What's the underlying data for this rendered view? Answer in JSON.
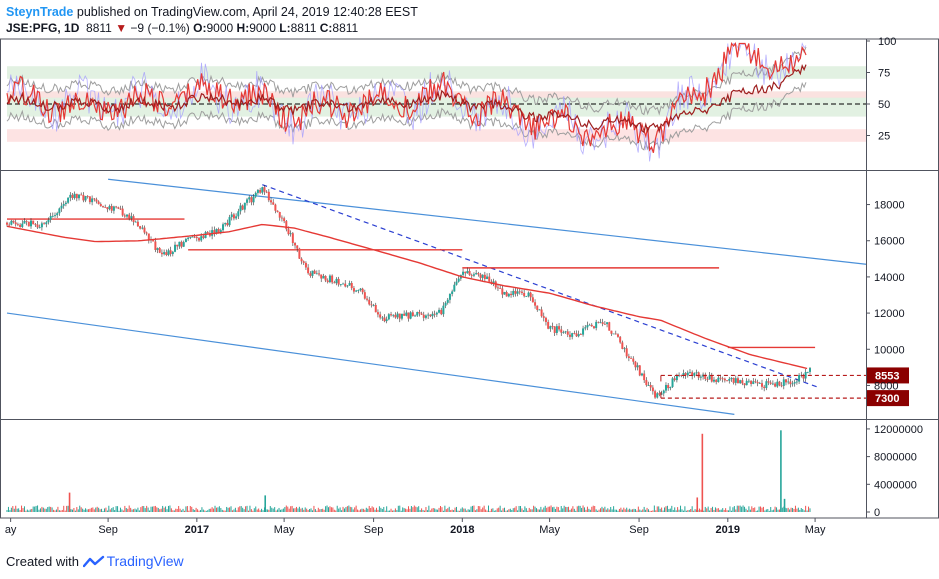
{
  "header": {
    "author": "SteynTrade",
    "published_text": "published on TradingView.com, April 24, 2019 12:40:28 EEST",
    "symbol": "JSE:PFG, 1D",
    "last": "8811",
    "change": "−9 (−0.1%)",
    "o_label": "O:",
    "o_value": "9000",
    "h_label": "H:",
    "h_value": "9000",
    "l_label": "L:",
    "l_value": "8811",
    "c_label": "C:",
    "c_value": "8811"
  },
  "footer": {
    "created_with": "Created with",
    "brand": "TradingView"
  },
  "colors": {
    "candle_up": "#26a69a",
    "candle_down": "#ef5350",
    "ma": "#e53935",
    "channel": "#4a90d9",
    "trendline": "#2b3fd1",
    "resistance": "#e53935",
    "support": "#b71c1c",
    "osc_main": "#e53935",
    "osc_signal": "#9e1f1f",
    "osc_fast": "#a29bfe",
    "osc_bands": "#9e9e9e",
    "zone_green": "#dff0df",
    "zone_red": "#fde0e0",
    "badge_bg": "#8b0000"
  },
  "chart_data": [
    {
      "type": "line",
      "panel": "oscillator",
      "y_axis_ticks": [
        "100",
        "75",
        "50",
        "25"
      ],
      "ylim": [
        0,
        100
      ],
      "reference_level": 50,
      "zones": [
        {
          "from": 70,
          "to": 80,
          "color": "green"
        },
        {
          "from": 40,
          "to": 60,
          "color": "green"
        },
        {
          "from": 55,
          "to": 60,
          "color": "red"
        },
        {
          "from": 20,
          "to": 30,
          "color": "red"
        }
      ],
      "x": [
        "2016-05",
        "2016-09",
        "2017-01",
        "2017-05",
        "2017-09",
        "2018-01",
        "2018-05",
        "2018-09",
        "2018-12",
        "2019-01",
        "2019-03",
        "2019-04"
      ],
      "series": [
        {
          "values": [
            55,
            48,
            52,
            60,
            42,
            50,
            58,
            40,
            30,
            28,
            90,
            78
          ]
        },
        {
          "values": [
            52,
            50,
            49,
            55,
            47,
            51,
            54,
            45,
            36,
            33,
            55,
            75
          ]
        }
      ]
    },
    {
      "type": "candlestick",
      "panel": "price",
      "y_axis_ticks": [
        "18000",
        "16000",
        "14000",
        "12000",
        "10000",
        "8000"
      ],
      "ylim": [
        6200,
        19800
      ],
      "x_ticks": [
        "ay",
        "Sep",
        "2017",
        "May",
        "Sep",
        "2018",
        "May",
        "Sep",
        "2019",
        "May"
      ],
      "x_range": [
        "2016-04-15",
        "2019-07-10"
      ],
      "price_path": [
        {
          "date": "2016-04-15",
          "price": 17000
        },
        {
          "date": "2016-06-01",
          "price": 16900
        },
        {
          "date": "2016-07-15",
          "price": 18500
        },
        {
          "date": "2016-08-20",
          "price": 18100
        },
        {
          "date": "2016-10-01",
          "price": 17400
        },
        {
          "date": "2016-11-15",
          "price": 15200
        },
        {
          "date": "2016-12-15",
          "price": 15900
        },
        {
          "date": "2017-02-01",
          "price": 16600
        },
        {
          "date": "2017-03-01",
          "price": 17700
        },
        {
          "date": "2017-04-01",
          "price": 18900
        },
        {
          "date": "2017-05-01",
          "price": 17000
        },
        {
          "date": "2017-06-01",
          "price": 14300
        },
        {
          "date": "2017-07-15",
          "price": 13700
        },
        {
          "date": "2017-08-15",
          "price": 13200
        },
        {
          "date": "2017-09-15",
          "price": 11700
        },
        {
          "date": "2017-11-01",
          "price": 11900
        },
        {
          "date": "2017-12-01",
          "price": 12000
        },
        {
          "date": "2018-01-05",
          "price": 14400
        },
        {
          "date": "2018-02-01",
          "price": 13900
        },
        {
          "date": "2018-03-01",
          "price": 13100
        },
        {
          "date": "2018-04-01",
          "price": 13100
        },
        {
          "date": "2018-05-01",
          "price": 11200
        },
        {
          "date": "2018-06-01",
          "price": 10800
        },
        {
          "date": "2018-07-15",
          "price": 11600
        },
        {
          "date": "2018-08-15",
          "price": 9800
        },
        {
          "date": "2018-09-25",
          "price": 7400
        },
        {
          "date": "2018-11-01",
          "price": 8800
        },
        {
          "date": "2018-12-01",
          "price": 8400
        },
        {
          "date": "2019-01-15",
          "price": 8200
        },
        {
          "date": "2019-03-01",
          "price": 8000
        },
        {
          "date": "2019-04-10",
          "price": 8400
        },
        {
          "date": "2019-04-24",
          "price": 8811
        }
      ],
      "moving_average": [
        {
          "date": "2016-04-15",
          "price": 16800
        },
        {
          "date": "2016-07-01",
          "price": 16200
        },
        {
          "date": "2016-08-15",
          "price": 15950
        },
        {
          "date": "2016-10-15",
          "price": 16000
        },
        {
          "date": "2017-01-01",
          "price": 16300
        },
        {
          "date": "2017-02-15",
          "price": 16500
        },
        {
          "date": "2017-04-01",
          "price": 16900
        },
        {
          "date": "2017-05-15",
          "price": 16700
        },
        {
          "date": "2017-07-01",
          "price": 16200
        },
        {
          "date": "2017-09-01",
          "price": 15500
        },
        {
          "date": "2017-11-01",
          "price": 14800
        },
        {
          "date": "2018-01-01",
          "price": 14000
        },
        {
          "date": "2018-03-01",
          "price": 13500
        },
        {
          "date": "2018-05-01",
          "price": 13100
        },
        {
          "date": "2018-07-01",
          "price": 12400
        },
        {
          "date": "2018-09-01",
          "price": 11800
        },
        {
          "date": "2018-10-01",
          "price": 11600
        },
        {
          "date": "2018-12-01",
          "price": 10600
        },
        {
          "date": "2019-02-01",
          "price": 9700
        },
        {
          "date": "2019-04-24",
          "price": 8900
        }
      ],
      "channel_upper": [
        {
          "date": "2016-09-01",
          "price": 19400
        },
        {
          "date": "2019-07-10",
          "price": 14700
        }
      ],
      "channel_lower": [
        {
          "date": "2016-04-15",
          "price": 12000
        },
        {
          "date": "2019-01-10",
          "price": 6400
        }
      ],
      "trendline": [
        {
          "date": "2017-04-01",
          "price": 19100
        },
        {
          "date": "2019-05-05",
          "price": 7900
        }
      ],
      "resistance_lines": [
        {
          "from": "2016-04-15",
          "to": "2016-12-15",
          "price": 17200
        },
        {
          "from": "2016-12-20",
          "to": "2018-01-01",
          "price": 15500
        },
        {
          "from": "2018-01-01",
          "to": "2018-12-20",
          "price": 14500
        },
        {
          "from": "2019-01-01",
          "to": "2019-05-01",
          "price": 10100
        }
      ],
      "support_lines": [
        {
          "from": "2018-10-01",
          "to": "2019-07-10",
          "price": 8553,
          "dashed": true
        },
        {
          "from": "2018-10-01",
          "to": "2019-07-10",
          "price": 7300,
          "dashed": true
        }
      ],
      "price_labels": [
        "8553",
        "7300"
      ]
    },
    {
      "type": "bar",
      "panel": "volume",
      "y_axis_ticks": [
        "12000000",
        "8000000",
        "4000000",
        "0"
      ],
      "ylim": [
        0,
        13000000
      ],
      "spikes": [
        {
          "date": "2016-07-10",
          "value": 2800000,
          "direction": "down"
        },
        {
          "date": "2017-04-05",
          "value": 2400000,
          "direction": "up"
        },
        {
          "date": "2018-11-20",
          "value": 2100000,
          "direction": "down"
        },
        {
          "date": "2018-11-27",
          "value": 11300000,
          "direction": "down"
        },
        {
          "date": "2019-03-15",
          "value": 11800000,
          "direction": "up"
        },
        {
          "date": "2019-03-20",
          "value": 1900000,
          "direction": "up"
        }
      ],
      "typical_value": 500000
    }
  ]
}
